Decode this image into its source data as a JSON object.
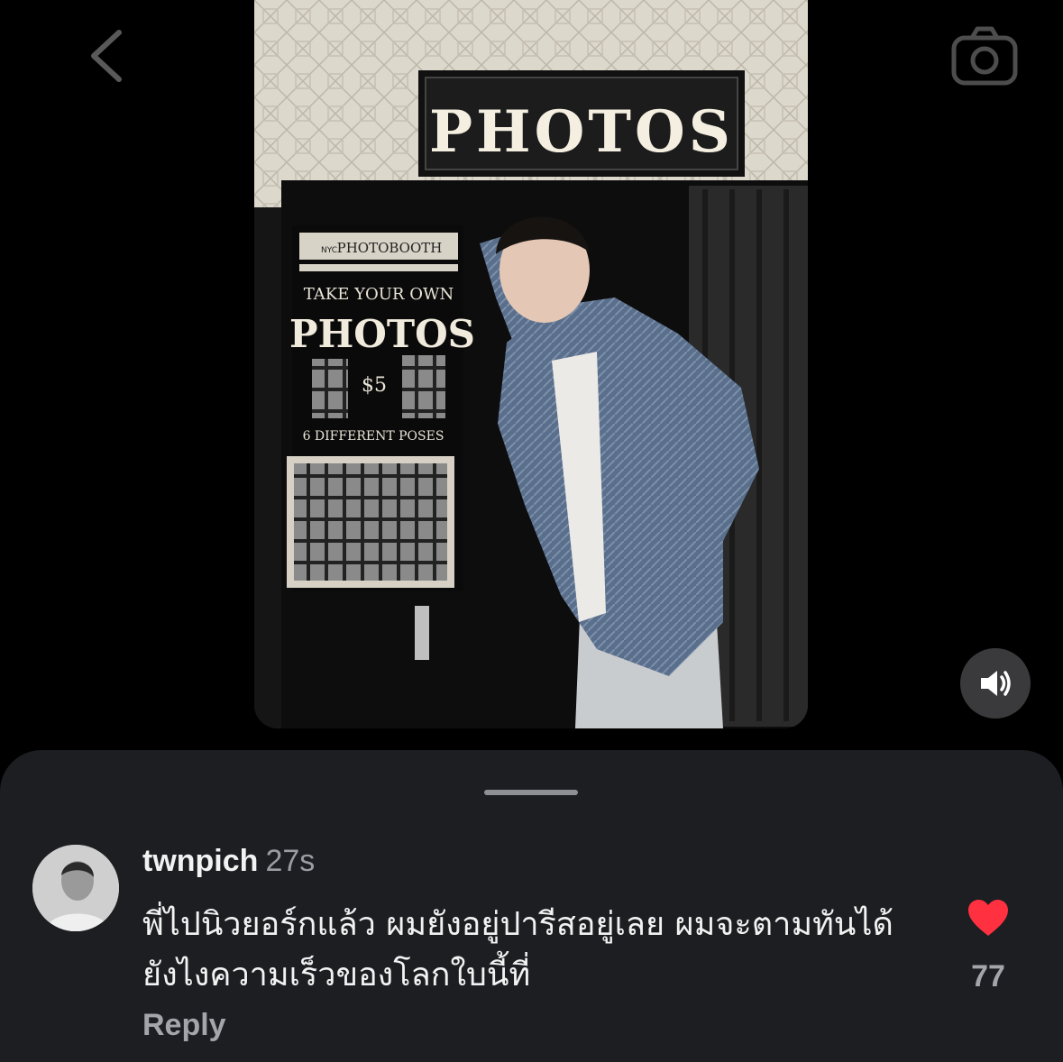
{
  "icons": {
    "back": "chevron-left-icon",
    "camera": "camera-icon",
    "sound": "speaker-icon",
    "like": "heart-icon"
  },
  "photo": {
    "sign_text": "PHOTOS",
    "booth_brand": "PHOTOBOOTH",
    "booth_nyc": "NYC",
    "booth_line1": "TAKE YOUR OWN",
    "booth_line2": "PHOTOS",
    "booth_price": "$5",
    "booth_line3": "6 DIFFERENT POSES"
  },
  "comment": {
    "username": "twnpich",
    "time": "27s",
    "text": "พี่ไปนิวยอร์กแล้ว ผมยังอยู่ปารีสอยู่เลย ผมจะตามทันได้ยังไงความเร็วของโลกใบนี้ที่",
    "reply_label": "Reply",
    "like_count": "77"
  },
  "colors": {
    "sheet_bg": "#1c1e22",
    "like_red": "#ff3040",
    "muted_text": "#9a9ca2"
  }
}
